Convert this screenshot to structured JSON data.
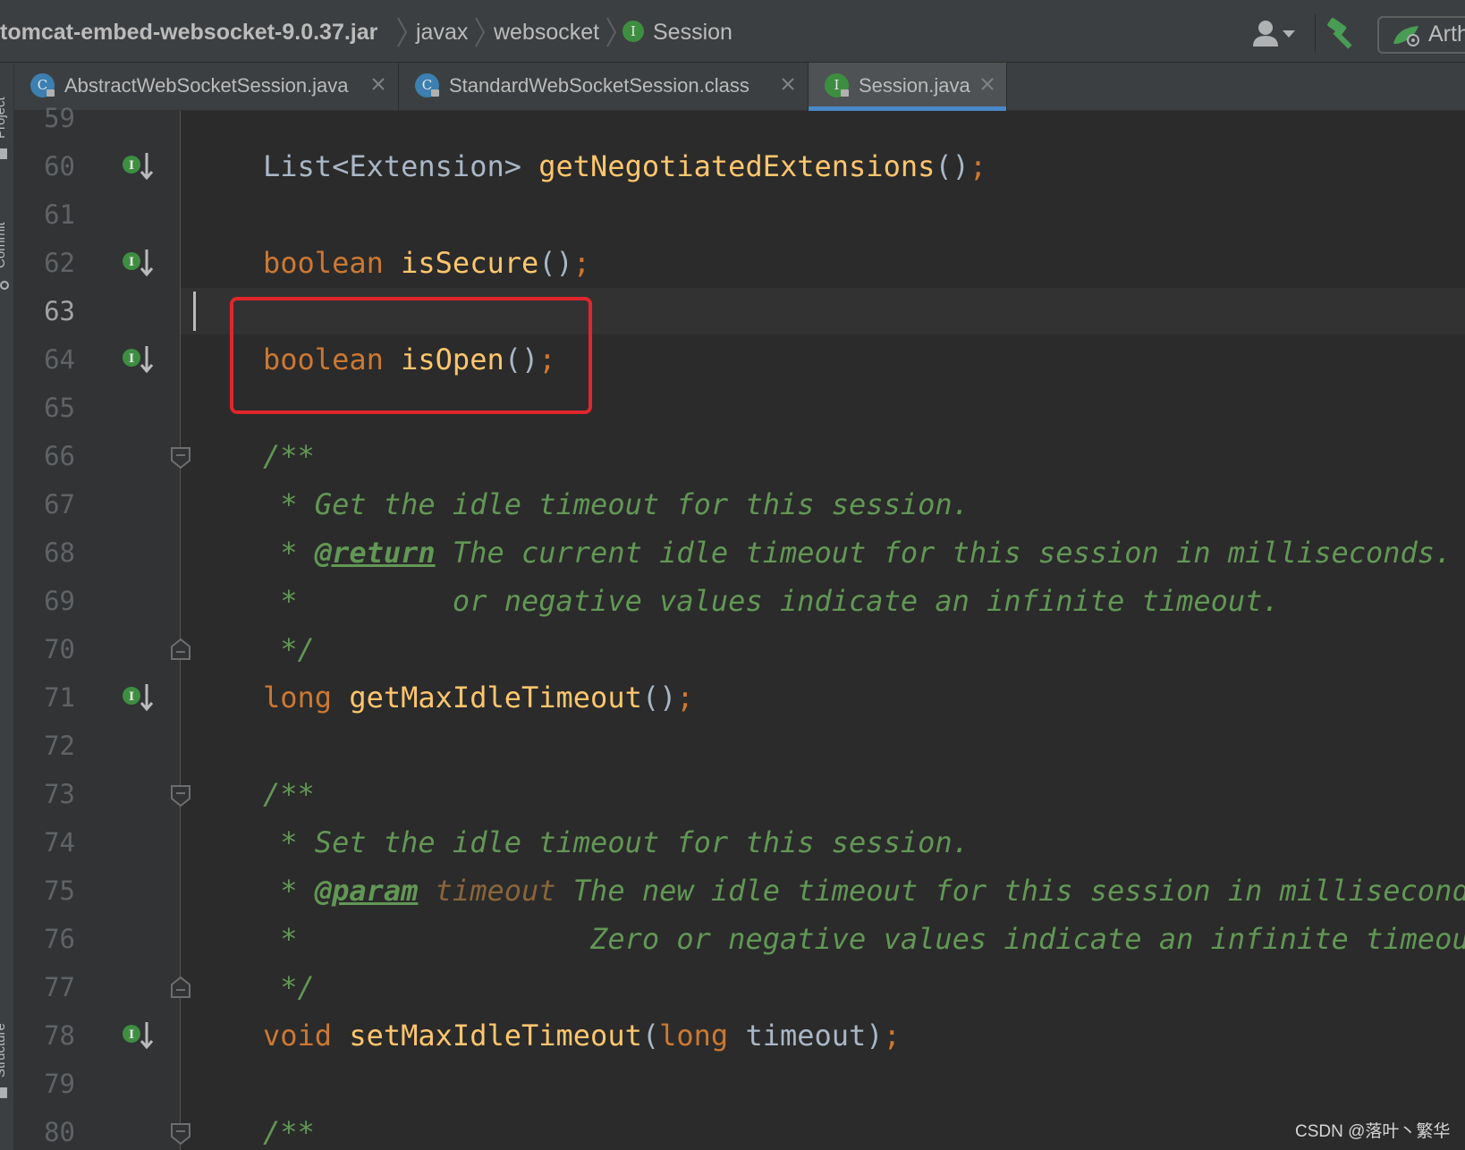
{
  "navbar": {
    "breadcrumbs": [
      "tomcat-embed-websocket-9.0.37.jar",
      "javax",
      "websocket",
      "Session"
    ],
    "session_badge": "I",
    "arthas_label": "Arth",
    "icons": {
      "user": "user-dropdown-icon",
      "build": "hammer-icon",
      "arthas": "arthas-icon"
    }
  },
  "tool_strip": {
    "top_label": "Project",
    "middle_label": "Commit",
    "bottom_label": "Structure"
  },
  "tabs": [
    {
      "label": "AbstractWebSocketSession.java",
      "icon": "C",
      "kind": "class",
      "active": false
    },
    {
      "label": "StandardWebSocketSession.class",
      "icon": "C",
      "kind": "class",
      "active": false
    },
    {
      "label": "Session.java",
      "icon": "I",
      "kind": "interface",
      "active": true
    }
  ],
  "gutter": {
    "line_numbers": [
      "59",
      "60",
      "61",
      "62",
      "63",
      "64",
      "65",
      "66",
      "67",
      "68",
      "69",
      "70",
      "71",
      "72",
      "73",
      "74",
      "75",
      "76",
      "77",
      "78",
      "79",
      "80"
    ],
    "current_line": "63",
    "implemented_marker": "I"
  },
  "code": {
    "l60": {
      "type": "List<Extension>",
      "name": "getNegotiatedExtensions",
      "tail": "();"
    },
    "l62": {
      "kw": "boolean",
      "name": "isSecure",
      "tail": "();"
    },
    "l64": {
      "kw": "boolean",
      "name": "isOpen",
      "tail": "();"
    },
    "l66": "/**",
    "l67": " * Get the idle timeout for this session.",
    "l68": {
      "lead": " * ",
      "tag": "@return",
      "text": " The current idle timeout for this session in milliseconds."
    },
    "l69": " *         or negative values indicate an infinite timeout.",
    "l70": " */",
    "l71": {
      "kw": "long",
      "name": "getMaxIdleTimeout",
      "tail": "();"
    },
    "l73": "/**",
    "l74": " * Set the idle timeout for this session.",
    "l75": {
      "lead": " * ",
      "tag": "@param",
      "param": "timeout",
      "text": " The new idle timeout for this session in millisecond"
    },
    "l76": " *                 Zero or negative values indicate an infinite timeout",
    "l77": " */",
    "l78": {
      "kw": "void",
      "name": "setMaxIdleTimeout",
      "open": "(",
      "ptype": "long",
      "pname": "timeout",
      "close": ");"
    },
    "l80": "/**"
  },
  "watermark": "CSDN @落叶丶繁华",
  "colors": {
    "keyword": "#cc7832",
    "method": "#ffc66d",
    "plain": "#a9b7c6",
    "comment": "#629755",
    "highlight_box": "#e0262b",
    "active_tab_underline": "#4a88c7",
    "interface_badge": "#3e8e41",
    "class_badge": "#3c7fb1"
  }
}
